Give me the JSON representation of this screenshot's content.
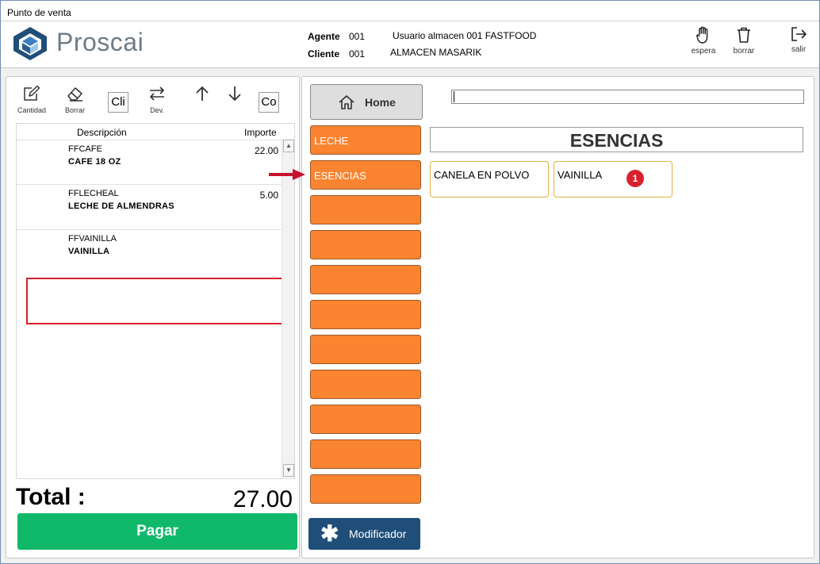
{
  "window": {
    "title": "Punto de venta"
  },
  "header": {
    "logo_text": "Proscai",
    "agente_label": "Agente",
    "agente_code": "001",
    "agente_name": "Usuario almacen 001 FASTFOOD",
    "cliente_label": "Cliente",
    "cliente_code": "001",
    "cliente_name": "ALMACEN MASARIK",
    "buttons": [
      {
        "label": "espera",
        "icon": "hand-icon"
      },
      {
        "label": "borrar",
        "icon": "trash-icon"
      },
      {
        "label": "salir",
        "icon": "exit-icon"
      }
    ]
  },
  "toolbar": {
    "cantidad": "Cantidad",
    "borrar": "Borrar",
    "cli": "Cli",
    "dev": "Dev.",
    "co": "Co"
  },
  "grid": {
    "headers": {
      "descripcion": "Descripción",
      "importe": "Importe"
    },
    "rows": [
      {
        "code": "FFCAFE",
        "name": "CAFE 18 OZ",
        "amount": "22.00"
      },
      {
        "code": "FFLECHEAL",
        "name": "LECHE DE ALMENDRAS",
        "amount": "5.00"
      },
      {
        "code": "FFVAINILLA",
        "name": "VAINILLA",
        "amount": ""
      }
    ]
  },
  "total": {
    "label": "Total :",
    "value": "27.00"
  },
  "pagar_label": "Pagar",
  "home_label": "Home",
  "categories": [
    "LECHE",
    "ESENCIAS",
    "",
    "",
    "",
    "",
    "",
    "",
    "",
    "",
    ""
  ],
  "modificador_label": "Modificador",
  "search": {
    "value": ""
  },
  "category_title": "ESENCIAS",
  "products": [
    "CANELA EN POLVO",
    "VAINILLA"
  ],
  "annotation_badge": "1",
  "colors": {
    "accent_orange": "#fb8431",
    "pay_green": "#10b96a",
    "highlight_red": "#d9212c",
    "modifier_blue": "#1f4e79"
  }
}
